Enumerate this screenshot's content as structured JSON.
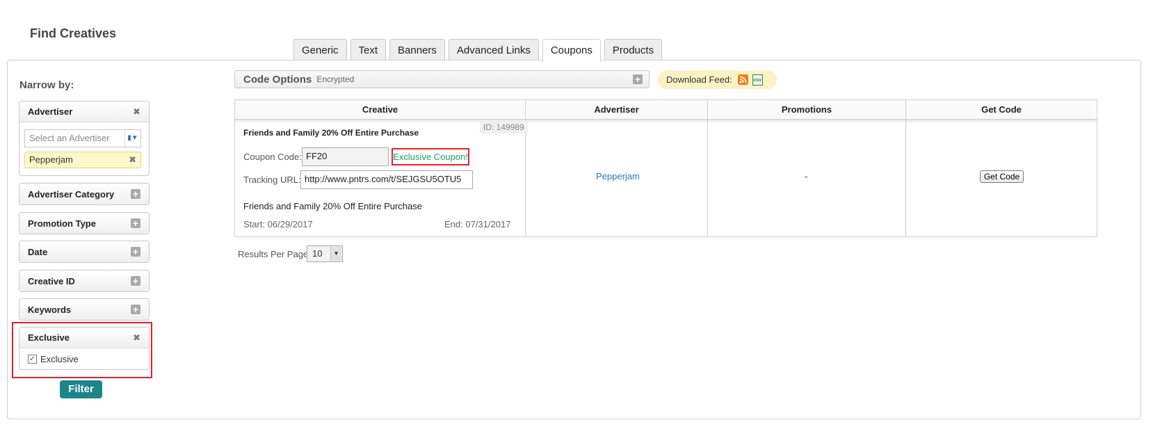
{
  "page": {
    "title": "Find Creatives"
  },
  "tabs": [
    {
      "label": "Generic",
      "active": false
    },
    {
      "label": "Text",
      "active": false
    },
    {
      "label": "Banners",
      "active": false
    },
    {
      "label": "Advanced Links",
      "active": false
    },
    {
      "label": "Coupons",
      "active": true
    },
    {
      "label": "Products",
      "active": false
    }
  ],
  "sidebar": {
    "narrow_label": "Narrow by:",
    "advertiser": {
      "title": "Advertiser",
      "select_placeholder": "Select an Advertiser",
      "selected_chip": "Pepperjam"
    },
    "facets": [
      {
        "title": "Advertiser Category"
      },
      {
        "title": "Promotion Type"
      },
      {
        "title": "Date"
      },
      {
        "title": "Creative ID"
      },
      {
        "title": "Keywords"
      }
    ],
    "exclusive": {
      "title": "Exclusive",
      "checkbox_label": "Exclusive",
      "checked": true
    },
    "filter_button": "Filter"
  },
  "code_options": {
    "title": "Code Options",
    "subtitle": "Encrypted"
  },
  "download_feed": {
    "label": "Download Feed:",
    "icons": [
      "rss-icon",
      "csv-icon"
    ],
    "csv_text": "csv"
  },
  "table": {
    "headers": [
      "Creative",
      "Advertiser",
      "Promotions",
      "Get Code"
    ],
    "rows": [
      {
        "id_label": "ID: 149989",
        "title": "Friends and Family 20% Off Entire Purchase",
        "coupon_code_label": "Coupon Code:",
        "coupon_code": "FF20",
        "exclusive_label": "Exclusive Coupon!",
        "tracking_url_label": "Tracking URL:",
        "tracking_url": "http://www.pntrs.com/t/SEJGSU5OTU5",
        "description": "Friends and Family 20% Off Entire Purchase",
        "start": "Start: 06/29/2017",
        "end": "End: 07/31/2017",
        "advertiser": "Pepperjam",
        "promotions": "-",
        "get_code_button": "Get Code"
      }
    ]
  },
  "results_per_page": {
    "label": "Results Per Page:",
    "value": "10"
  },
  "colors": {
    "filter_button": "#1a868a",
    "highlight_border": "#e41f2d",
    "exclusive_text": "#1ba464",
    "link": "#2a77b7",
    "chip_bg": "#fdf8c9",
    "feed_bg": "#fbf2c6"
  }
}
